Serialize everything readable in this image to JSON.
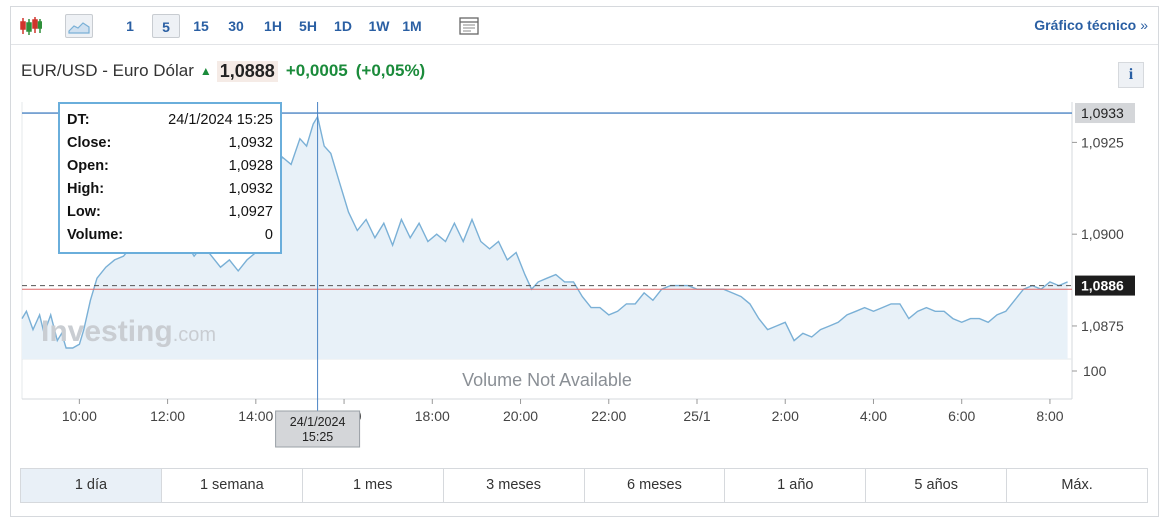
{
  "toolbar": {
    "icons": [
      "candlestick-icon",
      "area-chart-icon",
      "layout-icon"
    ],
    "timeframes": [
      "1",
      "5",
      "15",
      "30",
      "1H",
      "5H",
      "1D",
      "1W",
      "1M"
    ],
    "active_timeframe": "5",
    "technical_link": "Gráfico técnico",
    "technical_chevron": "»"
  },
  "header": {
    "instrument": "EUR/USD - Euro Dólar",
    "price": "1,0888",
    "change": "+0,0005",
    "change_pct": "(+0,05%)",
    "info": "i"
  },
  "tooltip": {
    "rows": [
      {
        "key": "DT:",
        "value": "24/1/2024 15:25"
      },
      {
        "key": "Close:",
        "value": "1,0932"
      },
      {
        "key": "Open:",
        "value": "1,0928"
      },
      {
        "key": "High:",
        "value": "1,0932"
      },
      {
        "key": "Low:",
        "value": "1,0927"
      },
      {
        "key": "Volume:",
        "value": "0"
      }
    ]
  },
  "crosshair": {
    "date_line1": "24/1/2024",
    "date_line2": "15:25",
    "price_label": "1,0933",
    "price": 1.0933,
    "time_hours": 15.4
  },
  "chart_data": {
    "type": "area",
    "x_unit": "hours since 24/1 00:00",
    "xlim": [
      8.7,
      32.5
    ],
    "ylim": [
      1.0866,
      1.0936
    ],
    "y_ticks": [
      {
        "value": 1.0925,
        "label": "1,0925"
      },
      {
        "value": 1.09,
        "label": "1,0900"
      },
      {
        "value": 1.0875,
        "label": "1,0875"
      }
    ],
    "x_ticks": [
      {
        "value": 10,
        "label": "10:00"
      },
      {
        "value": 12,
        "label": "12:00"
      },
      {
        "value": 14,
        "label": "14:00"
      },
      {
        "value": 16,
        "label": "16:00"
      },
      {
        "value": 18,
        "label": "18:00"
      },
      {
        "value": 20,
        "label": "20:00"
      },
      {
        "value": 22,
        "label": "22:00"
      },
      {
        "value": 24,
        "label": "25/1"
      },
      {
        "value": 26,
        "label": "2:00"
      },
      {
        "value": 28,
        "label": "4:00"
      },
      {
        "value": 30,
        "label": "6:00"
      },
      {
        "value": 32,
        "label": "8:00"
      }
    ],
    "current_price": {
      "value": 1.0886,
      "label": "1,0886"
    },
    "reference_line": 1.0885,
    "volume_axis_label": "100",
    "volume_note": "Volume Not Available",
    "watermark": "Investing",
    "watermark_suffix": ".com",
    "series": [
      {
        "x": [
          8.7,
          8.8,
          8.95,
          9.1,
          9.2,
          9.35,
          9.5,
          9.6,
          9.7,
          9.85,
          10.0,
          10.1,
          10.25,
          10.4,
          10.6,
          10.8,
          11.0,
          11.2,
          11.4,
          11.6,
          11.8,
          12.0,
          12.2,
          12.4,
          12.6,
          12.8,
          13.0,
          13.2,
          13.4,
          13.6,
          13.8,
          14.0,
          14.1,
          14.25,
          14.4,
          14.6,
          14.8,
          15.0,
          15.15,
          15.3,
          15.4,
          15.55,
          15.7,
          15.9,
          16.1,
          16.3,
          16.5,
          16.7,
          16.9,
          17.1,
          17.3,
          17.5,
          17.7,
          17.9,
          18.1,
          18.3,
          18.5,
          18.7,
          18.9,
          19.1,
          19.3,
          19.5,
          19.7,
          19.9,
          20.1,
          20.25,
          20.4,
          20.6,
          20.8,
          21.0,
          21.2,
          21.4,
          21.6,
          21.8,
          22.0,
          22.2,
          22.4,
          22.6,
          22.8,
          23.0,
          23.2,
          23.4,
          23.6,
          23.8,
          24.0,
          24.2,
          24.4,
          24.6,
          24.8,
          25.0,
          25.2,
          25.4,
          25.6,
          25.8,
          26.0,
          26.2,
          26.4,
          26.6,
          26.8,
          27.0,
          27.2,
          27.4,
          27.6,
          27.8,
          28.0,
          28.2,
          28.4,
          28.6,
          28.8,
          29.0,
          29.2,
          29.4,
          29.6,
          29.8,
          30.0,
          30.2,
          30.4,
          30.6,
          30.8,
          31.0,
          31.2,
          31.4,
          31.6,
          31.8,
          32.0,
          32.2,
          32.4
        ],
        "y": [
          1.0877,
          1.0879,
          1.0874,
          1.0878,
          1.0873,
          1.0878,
          1.0871,
          1.0873,
          1.0869,
          1.0869,
          1.087,
          1.0874,
          1.0882,
          1.0888,
          1.0891,
          1.0893,
          1.0894,
          1.0897,
          1.0895,
          1.0899,
          1.0897,
          1.0898,
          1.0895,
          1.0898,
          1.0894,
          1.0897,
          1.0894,
          1.0891,
          1.0893,
          1.089,
          1.0893,
          1.0895,
          1.0903,
          1.0907,
          1.0916,
          1.0921,
          1.0919,
          1.0926,
          1.0924,
          1.093,
          1.0932,
          1.0924,
          1.0922,
          1.0914,
          1.0906,
          1.0901,
          1.0904,
          1.0899,
          1.0903,
          1.0897,
          1.0904,
          1.0899,
          1.0903,
          1.0898,
          1.09,
          1.0898,
          1.0903,
          1.0898,
          1.0904,
          1.0898,
          1.0896,
          1.0898,
          1.0893,
          1.0895,
          1.0889,
          1.0885,
          1.0887,
          1.0888,
          1.0889,
          1.0887,
          1.0887,
          1.0883,
          1.088,
          1.088,
          1.0878,
          1.0879,
          1.0881,
          1.0881,
          1.0884,
          1.0882,
          1.0885,
          1.0886,
          1.0886,
          1.0886,
          1.0885,
          1.0885,
          1.0885,
          1.0885,
          1.0884,
          1.0883,
          1.0881,
          1.0877,
          1.0874,
          1.0875,
          1.0876,
          1.0871,
          1.0873,
          1.0872,
          1.0874,
          1.0875,
          1.0876,
          1.0878,
          1.0879,
          1.088,
          1.0879,
          1.088,
          1.0881,
          1.0881,
          1.0877,
          1.0879,
          1.088,
          1.0879,
          1.0879,
          1.0877,
          1.0876,
          1.0877,
          1.0877,
          1.0876,
          1.0878,
          1.0879,
          1.0882,
          1.0885,
          1.0886,
          1.0885,
          1.0887,
          1.0886,
          1.0887
        ]
      }
    ]
  },
  "ranges": [
    "1 día",
    "1 semana",
    "1 mes",
    "3 meses",
    "6 meses",
    "1 año",
    "5 años",
    "Máx."
  ],
  "active_range": "1 día",
  "colors": {
    "line": "#7ab0d6",
    "fill": "#e8f1f8",
    "accent": "#2a5fa3",
    "up": "#1b8b3b",
    "crosshair": "#4a84c4",
    "reference": "#e06b6b"
  }
}
